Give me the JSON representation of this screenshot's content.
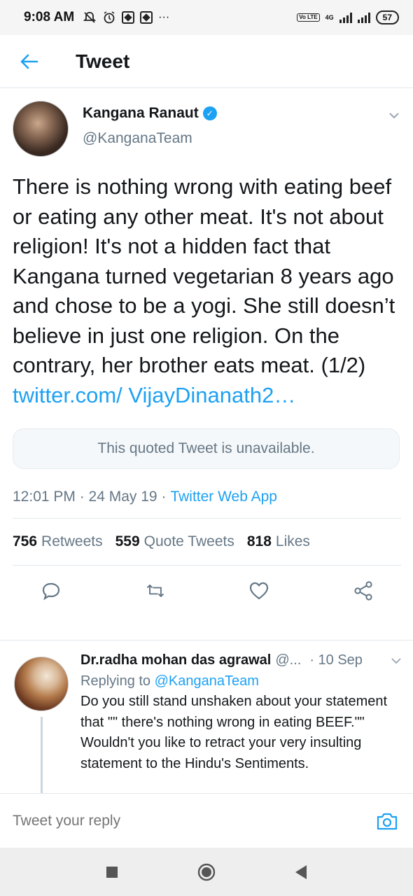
{
  "status_bar": {
    "time": "9:08 AM",
    "extra": "···",
    "network_label": "4G",
    "volte_label": "Vo LTE",
    "battery": "57"
  },
  "header": {
    "title": "Tweet",
    "back_icon": "arrow-left-icon"
  },
  "tweet": {
    "author_name": "Kangana Ranaut",
    "author_handle": "@KanganaTeam",
    "verified": true,
    "text": "There is nothing wrong with eating beef or eating any other meat. It's not about religion! It's not a hidden fact that Kangana turned vegetarian 8 years ago and chose to be a yogi. She still doesn’t believe in just one religion. On the contrary, her brother eats meat. (1/2) ",
    "link_text": "twitter.com/ VijayDinanath2…",
    "quoted_unavailable": "This quoted Tweet is unavailable.",
    "time": "12:01 PM · 24 May 19 · ",
    "source": "Twitter Web App",
    "retweets_count": "756",
    "retweets_label": "Retweets",
    "quotes_count": "559",
    "quotes_label": "Quote Tweets",
    "likes_count": "818",
    "likes_label": "Likes"
  },
  "reply": {
    "name": "Dr.radha mohan das agrawal",
    "handle": "@...",
    "time": "· 10 Sep",
    "replying_prefix": "Replying to ",
    "replying_handle": "@KanganaTeam",
    "text": "Do you still stand unshaken about your statement that \"\" there's nothing wrong in eating BEEF.\"\" Wouldn't you like to retract your very insulting statement to the Hindu's Sentiments."
  },
  "composer": {
    "placeholder": "Tweet your reply"
  },
  "colors": {
    "accent": "#1da1f2",
    "secondary_text": "#657786",
    "divider": "#e1e8ed"
  }
}
